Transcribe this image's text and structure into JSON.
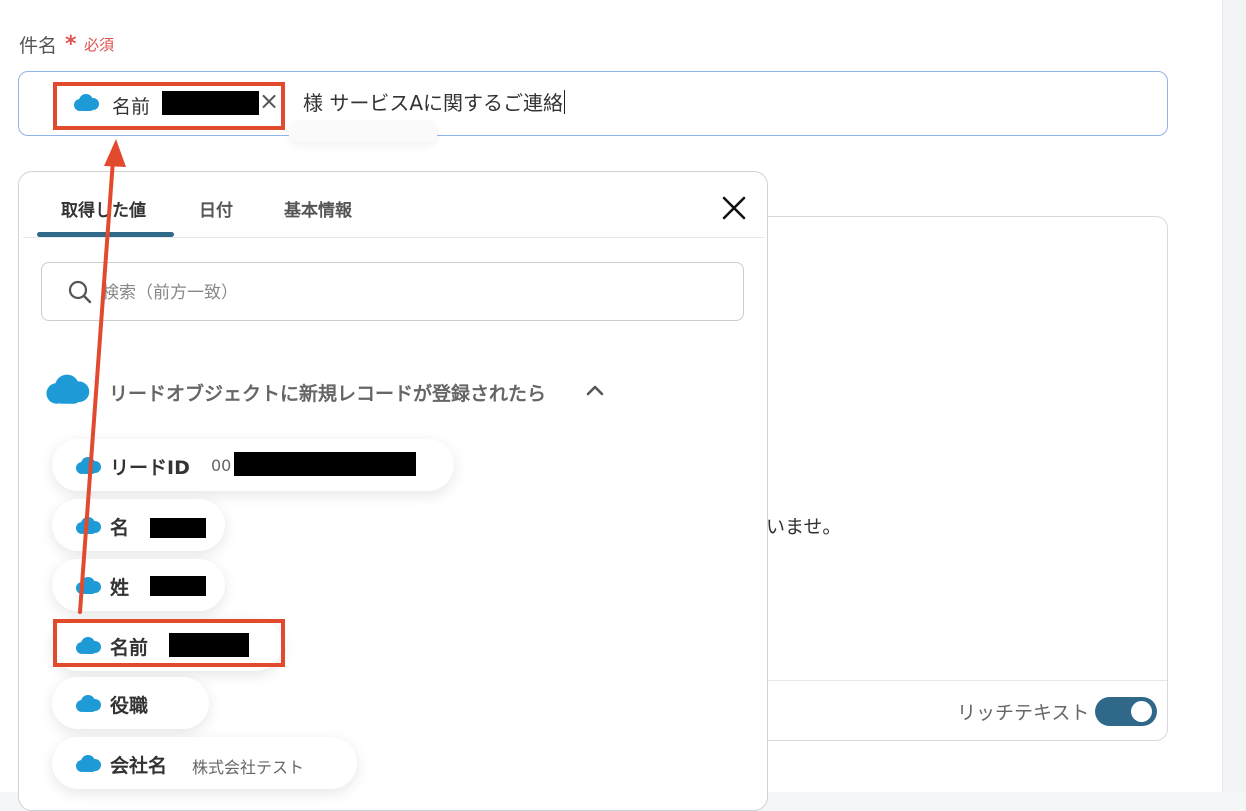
{
  "field": {
    "label": "件名",
    "required_mark": "*",
    "required_text": "必須"
  },
  "subject": {
    "token_label": "名前",
    "token_remove_icon": "close-icon",
    "text": "様 サービスAに関するご連絡"
  },
  "body_preview": {
    "text_fragment": "いませ。"
  },
  "editor": {
    "rich_text_label": "リッチテキスト",
    "rich_text_enabled": true
  },
  "popup": {
    "tabs": [
      {
        "label": "取得した値",
        "active": true
      },
      {
        "label": "日付",
        "active": false
      },
      {
        "label": "基本情報",
        "active": false
      }
    ],
    "close_icon": "close-icon",
    "search": {
      "placeholder": "検索（前方一致）",
      "value": "",
      "icon": "search-icon"
    },
    "section": {
      "title": "リードオブジェクトに新規レコードが登録されたら",
      "icon": "salesforce-cloud-icon",
      "toggle_icon": "chevron-up-icon",
      "expanded": true
    },
    "items": [
      {
        "label": "リードID",
        "value_prefix": "00"
      },
      {
        "label": "名"
      },
      {
        "label": "姓"
      },
      {
        "label": "名前"
      },
      {
        "label": "役職"
      },
      {
        "label": "会社名",
        "value": "株式会社テスト"
      }
    ]
  },
  "colors": {
    "accent": "#2f6889",
    "required": "#e05050",
    "annotation": "#e24a2d",
    "salesforce_cloud": "#1e9bd7",
    "input_focus_border": "#8fb4e8"
  }
}
